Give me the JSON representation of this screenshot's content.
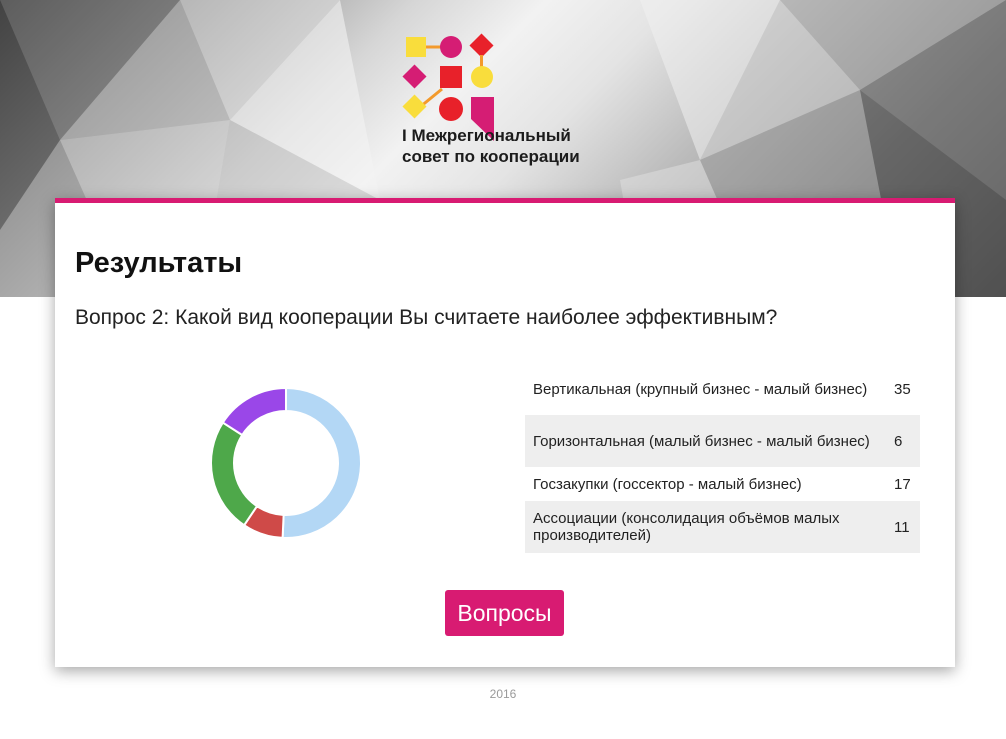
{
  "brand": {
    "line1": "I Межрегиональный",
    "line2": "совет по кооперации"
  },
  "page": {
    "heading": "Результаты",
    "question": "Вопрос 2: Какой вид кооперации Вы считаете наиболее эффективным?"
  },
  "results": [
    {
      "label": "Вертикальная (крупный бизнес - малый бизнес)",
      "count": "35",
      "color": "#b3d7f5"
    },
    {
      "label": "Горизонтальная (малый бизнес - малый бизнес)",
      "count": "6",
      "color": "#cf4a48"
    },
    {
      "label": "Госзакупки (госсектор - малый бизнес)",
      "count": "17",
      "color": "#4ea84a"
    },
    {
      "label": "Ассоциации (консолидация объёмов малых производителей)",
      "count": "11",
      "color": "#9a47e8"
    }
  ],
  "chart_data": {
    "type": "pie",
    "categories": [
      "Вертикальная (крупный бизнес - малый бизнес)",
      "Горизонтальная (малый бизнес - малый бизнес)",
      "Госзакупки (госсектор - малый бизнес)",
      "Ассоциации (консолидация объёмов малых производителей)"
    ],
    "values": [
      35,
      6,
      17,
      11
    ],
    "colors": [
      "#b3d7f5",
      "#cf4a48",
      "#4ea84a",
      "#9a47e8"
    ],
    "donut": true
  },
  "actions": {
    "questions_button": "Вопросы"
  },
  "footer": {
    "year": "2016"
  },
  "colors": {
    "accent": "#d81b72",
    "logo_yellow": "#f9dd3c",
    "logo_magenta": "#d51d74",
    "logo_red": "#e8212a",
    "logo_orange": "#f39a2c"
  }
}
